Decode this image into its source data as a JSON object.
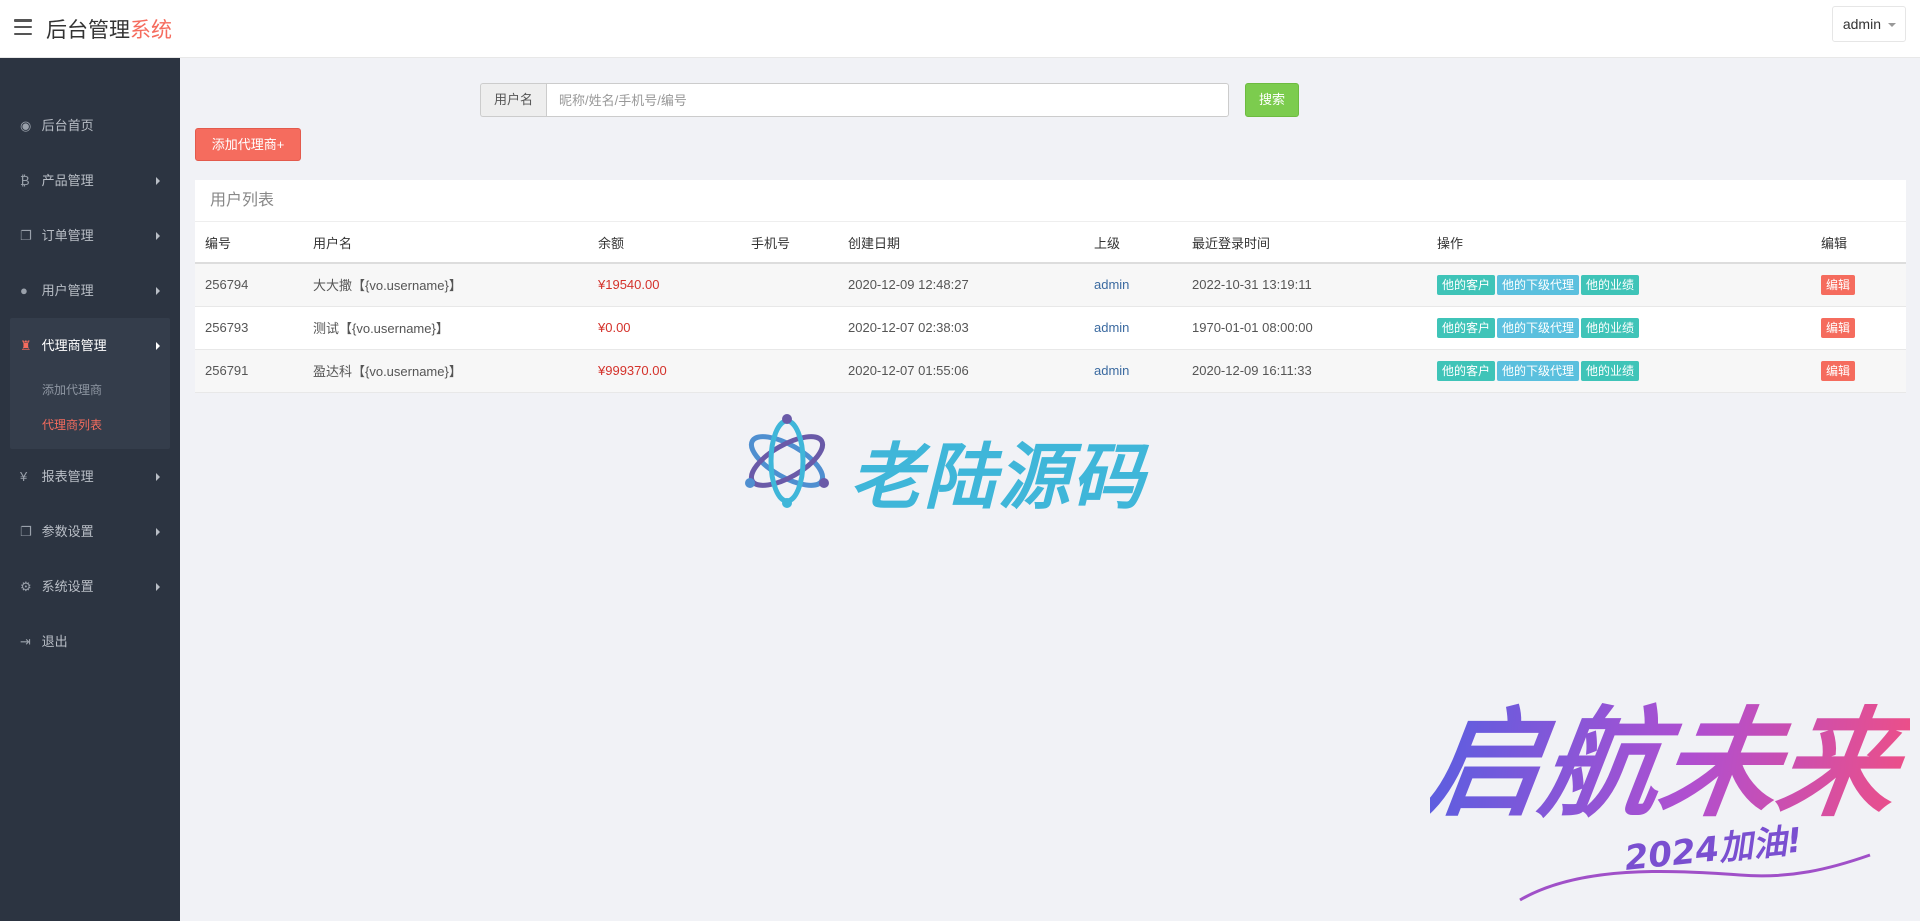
{
  "header": {
    "brand_main": "后台管理",
    "brand_accent": "系统",
    "user_label": "admin"
  },
  "sidebar": {
    "items": [
      {
        "label": "后台首页",
        "icon": "dashboard-icon",
        "has_arrow": false
      },
      {
        "label": "产品管理",
        "icon": "bitcoin-icon",
        "has_arrow": true
      },
      {
        "label": "订单管理",
        "icon": "copy-icon",
        "has_arrow": true
      },
      {
        "label": "用户管理",
        "icon": "user-icon",
        "has_arrow": true
      },
      {
        "label": "代理商管理",
        "icon": "sitemap-icon",
        "has_arrow": true,
        "open": true,
        "children": [
          {
            "label": "添加代理商",
            "active": false
          },
          {
            "label": "代理商列表",
            "active": true
          }
        ]
      },
      {
        "label": "报表管理",
        "icon": "yen-icon",
        "has_arrow": true
      },
      {
        "label": "参数设置",
        "icon": "copy-icon",
        "has_arrow": true
      },
      {
        "label": "系统设置",
        "icon": "gears-icon",
        "has_arrow": true
      },
      {
        "label": "退出",
        "icon": "sign-out-icon",
        "has_arrow": false
      }
    ]
  },
  "search": {
    "addon_label": "用户名",
    "placeholder": "昵称/姓名/手机号/编号",
    "value": "",
    "button_label": "搜索"
  },
  "add_button_label": "添加代理商+",
  "panel": {
    "title": "用户列表",
    "columns": [
      "编号",
      "用户名",
      "余额",
      "手机号",
      "创建日期",
      "上级",
      "最近登录时间",
      "操作",
      "编辑"
    ],
    "rows": [
      {
        "id": "256794",
        "username": "大大撒【{vo.username}】",
        "balance": "¥19540.00",
        "phone": "",
        "created": "2020-12-09 12:48:27",
        "parent": "admin",
        "last_login": "2022-10-31 13:19:11"
      },
      {
        "id": "256793",
        "username": "测试【{vo.username}】",
        "balance": "¥0.00",
        "phone": "",
        "created": "2020-12-07 02:38:03",
        "parent": "admin",
        "last_login": "1970-01-01 08:00:00"
      },
      {
        "id": "256791",
        "username": "盈达科【{vo.username}】",
        "balance": "¥999370.00",
        "phone": "",
        "created": "2020-12-07 01:55:06",
        "parent": "admin",
        "last_login": "2020-12-09 16:11:33"
      }
    ],
    "actions": [
      "他的客户",
      "他的下级代理",
      "他的业绩"
    ],
    "edit_label": "编辑"
  },
  "watermarks": {
    "logo_text": "老陆源码",
    "slogan_main": "启航未来",
    "slogan_sub": "2024加油!"
  },
  "colors": {
    "accent": "#f56c5e",
    "sidebar_bg": "#2c3441",
    "success": "#7ccc4e",
    "teal": "#3fc4b8",
    "info": "#5bc0de",
    "money": "#d4322b"
  }
}
